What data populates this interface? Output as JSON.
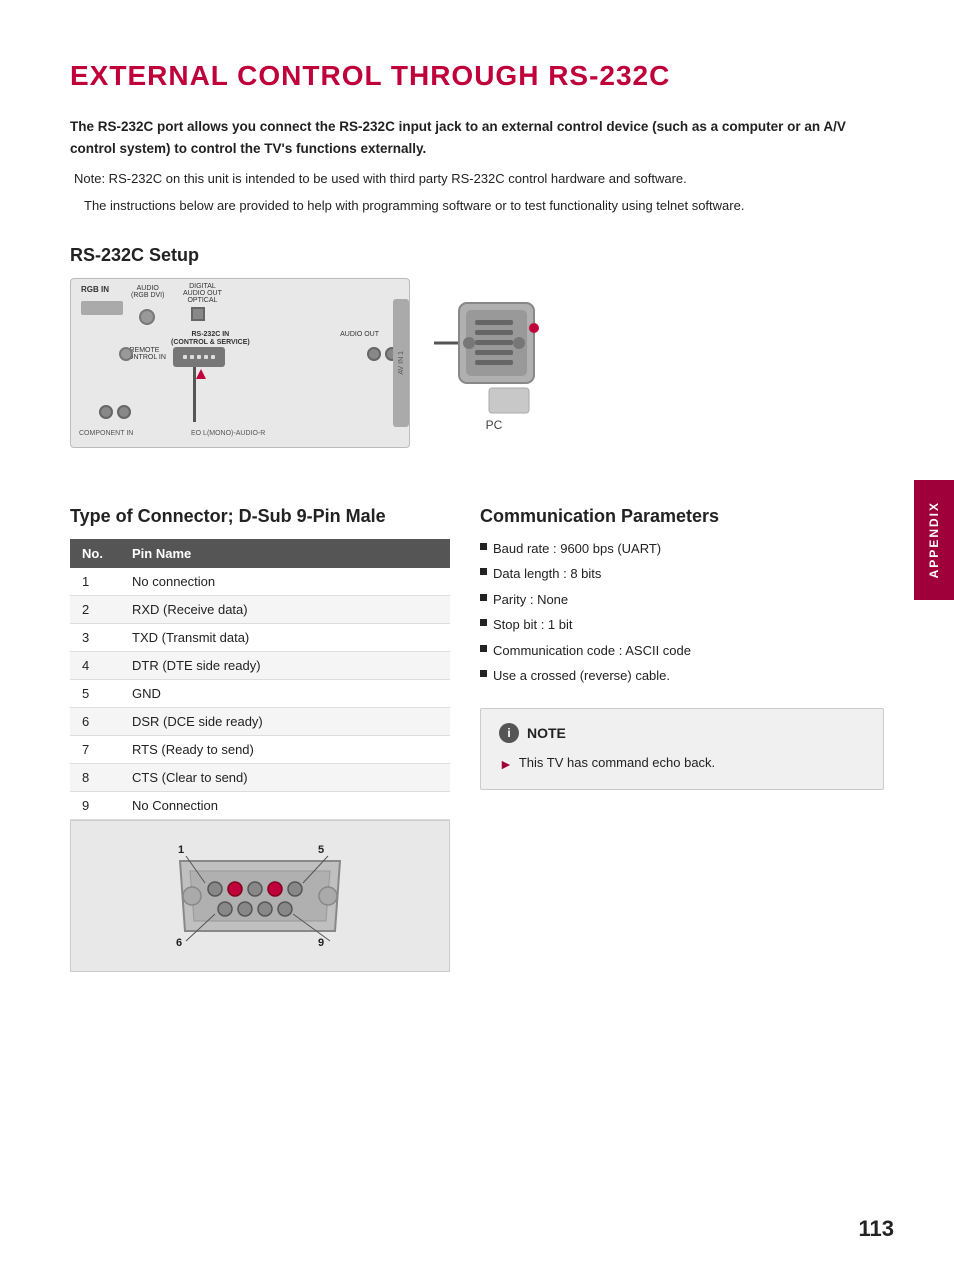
{
  "page": {
    "title": "EXTERNAL CONTROL THROUGH RS-232C",
    "page_number": "113",
    "sidebar_label": "APPENDIX"
  },
  "intro": {
    "paragraph": "The RS-232C port allows you connect the RS-232C input jack to an external control device (such as a computer or an A/V control system) to control the TV's functions externally.",
    "note_line1": "Note: RS-232C on this unit is intended to be used with third party RS-232C control hardware and software.",
    "note_line2": "The instructions below are provided to help with programming software or to test functionality using telnet software."
  },
  "setup_section": {
    "heading": "RS-232C Setup",
    "pc_label": "PC"
  },
  "connector_section": {
    "heading": "Type of Connector; D-Sub 9-Pin Male",
    "table_headers": [
      "No.",
      "Pin Name"
    ],
    "table_rows": [
      {
        "no": "1",
        "pin": "No connection"
      },
      {
        "no": "2",
        "pin": "RXD (Receive data)"
      },
      {
        "no": "3",
        "pin": "TXD (Transmit data)"
      },
      {
        "no": "4",
        "pin": "DTR (DTE side ready)"
      },
      {
        "no": "5",
        "pin": "GND"
      },
      {
        "no": "6",
        "pin": "DSR (DCE side ready)"
      },
      {
        "no": "7",
        "pin": "RTS (Ready to send)"
      },
      {
        "no": "8",
        "pin": "CTS (Clear to send)"
      },
      {
        "no": "9",
        "pin": "No Connection"
      }
    ],
    "pin1_label": "1",
    "pin5_label": "5",
    "pin6_label": "6",
    "pin9_label": "9"
  },
  "comm_section": {
    "heading": "Communication Parameters",
    "params": [
      "Baud rate : 9600 bps (UART)",
      "Data length : 8 bits",
      "Parity : None",
      "Stop bit : 1  bit",
      "Communication code : ASCII code",
      "Use a crossed (reverse) cable."
    ]
  },
  "note_box": {
    "header": "NOTE",
    "item": "This TV has command echo back."
  }
}
